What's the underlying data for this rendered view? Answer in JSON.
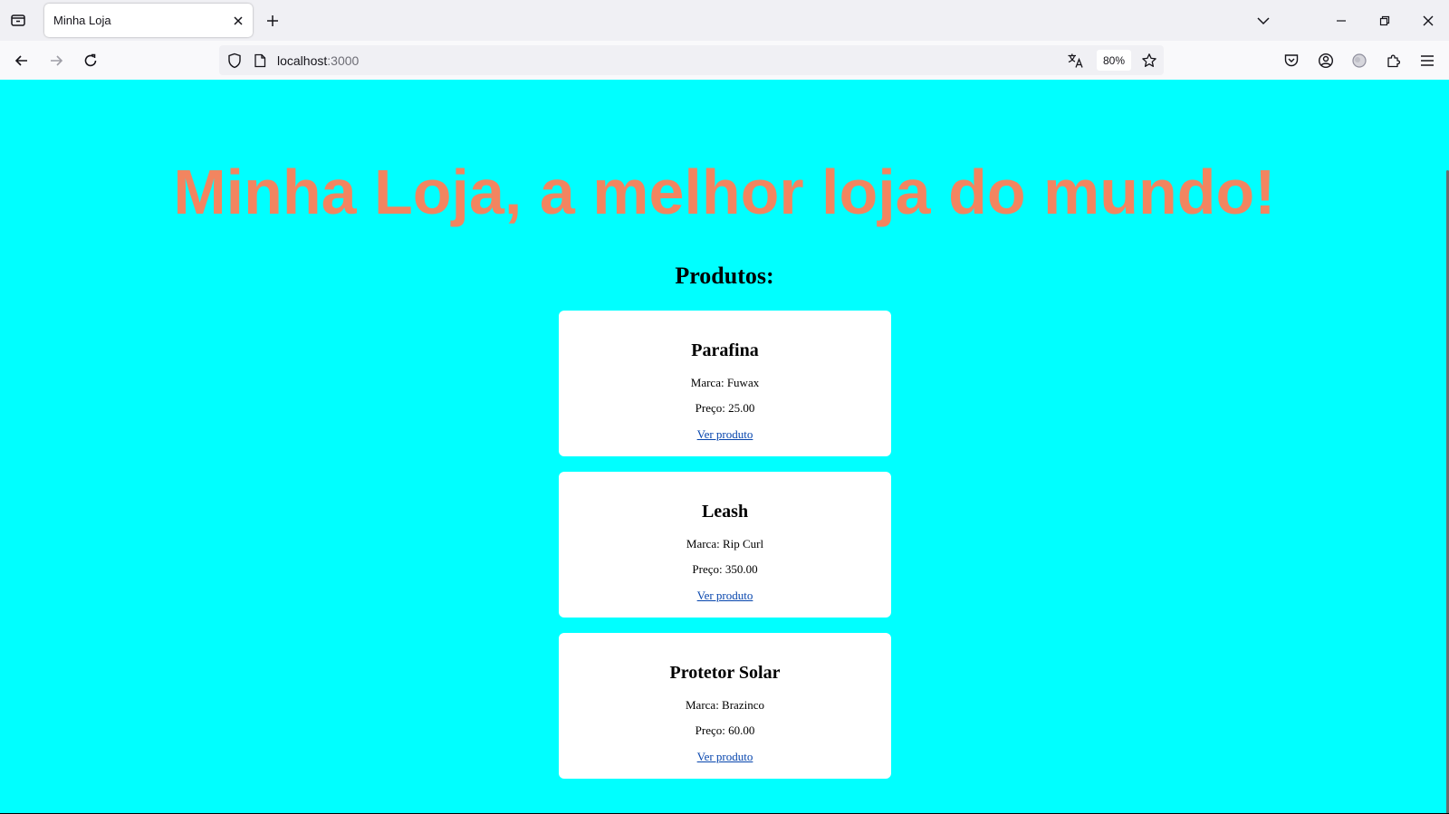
{
  "browser": {
    "tab": {
      "title": "Minha Loja"
    },
    "url": {
      "host": "localhost",
      "port": ":3000"
    },
    "zoom": "80%"
  },
  "page": {
    "headline": "Minha Loja, a melhor loja do mundo!",
    "section_title": "Produtos:",
    "colors": {
      "background": "#00ffff",
      "headline": "#f28560",
      "card": "#ffffff"
    },
    "products": [
      {
        "name": "Parafina",
        "brand": "Marca: Fuwax",
        "price": "Preço: 25.00",
        "link": "Ver produto"
      },
      {
        "name": "Leash",
        "brand": "Marca: Rip Curl",
        "price": "Preço: 350.00",
        "link": "Ver produto"
      },
      {
        "name": "Protetor Solar",
        "brand": "Marca: Brazinco",
        "price": "Preço: 60.00",
        "link": "Ver produto"
      }
    ]
  }
}
